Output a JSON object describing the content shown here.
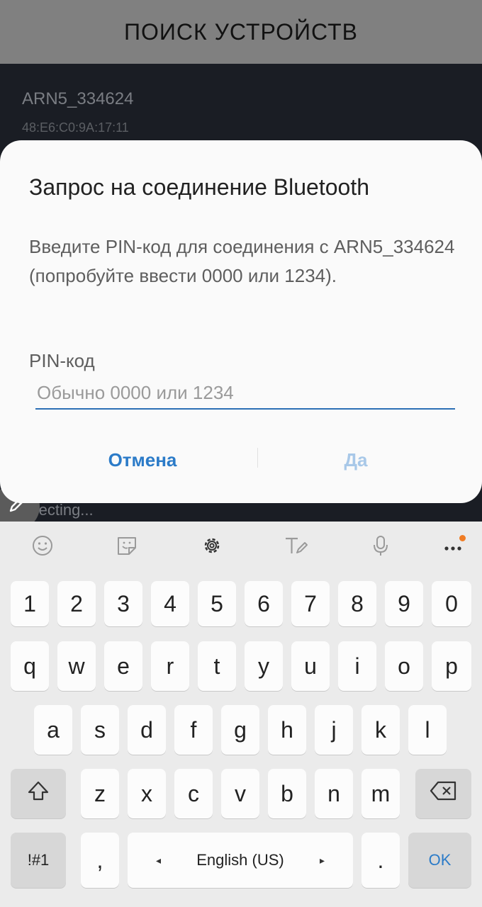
{
  "header": {
    "title": "ПОИСК УСТРОЙСТВ"
  },
  "device": {
    "name": "ARN5_334624",
    "mac": "48:E6:C0:9A:17:11"
  },
  "status_text": "Connecting...",
  "dialog": {
    "title": "Запрос на соединение Bluetooth",
    "message": "Введите PIN-код для соединения с ARN5_334624 (попробуйте ввести 0000 или 1234).",
    "pin_label": "PIN-код",
    "pin_placeholder": "Обычно 0000 или 1234",
    "pin_value": "",
    "cancel_label": "Отмена",
    "ok_label": "Да"
  },
  "keyboard": {
    "toolbar_icons": [
      "emoji-icon",
      "sticker-icon",
      "settings-icon",
      "handwriting-icon",
      "mic-icon",
      "more-icon"
    ],
    "row_numbers": [
      "1",
      "2",
      "3",
      "4",
      "5",
      "6",
      "7",
      "8",
      "9",
      "0"
    ],
    "row_q": [
      "q",
      "w",
      "e",
      "r",
      "t",
      "y",
      "u",
      "i",
      "o",
      "p"
    ],
    "row_a": [
      "a",
      "s",
      "d",
      "f",
      "g",
      "h",
      "j",
      "k",
      "l"
    ],
    "row_z": [
      "z",
      "x",
      "c",
      "v",
      "b",
      "n",
      "m"
    ],
    "symbols_label": "!#1",
    "comma_label": ",",
    "space_label": "English (US)",
    "period_label": ".",
    "ok_label": "OK"
  },
  "colors": {
    "accent": "#2b7bc8",
    "ok_disabled": "#a8c8e8",
    "header_bg": "#808080",
    "notification_dot": "#f07c24"
  }
}
